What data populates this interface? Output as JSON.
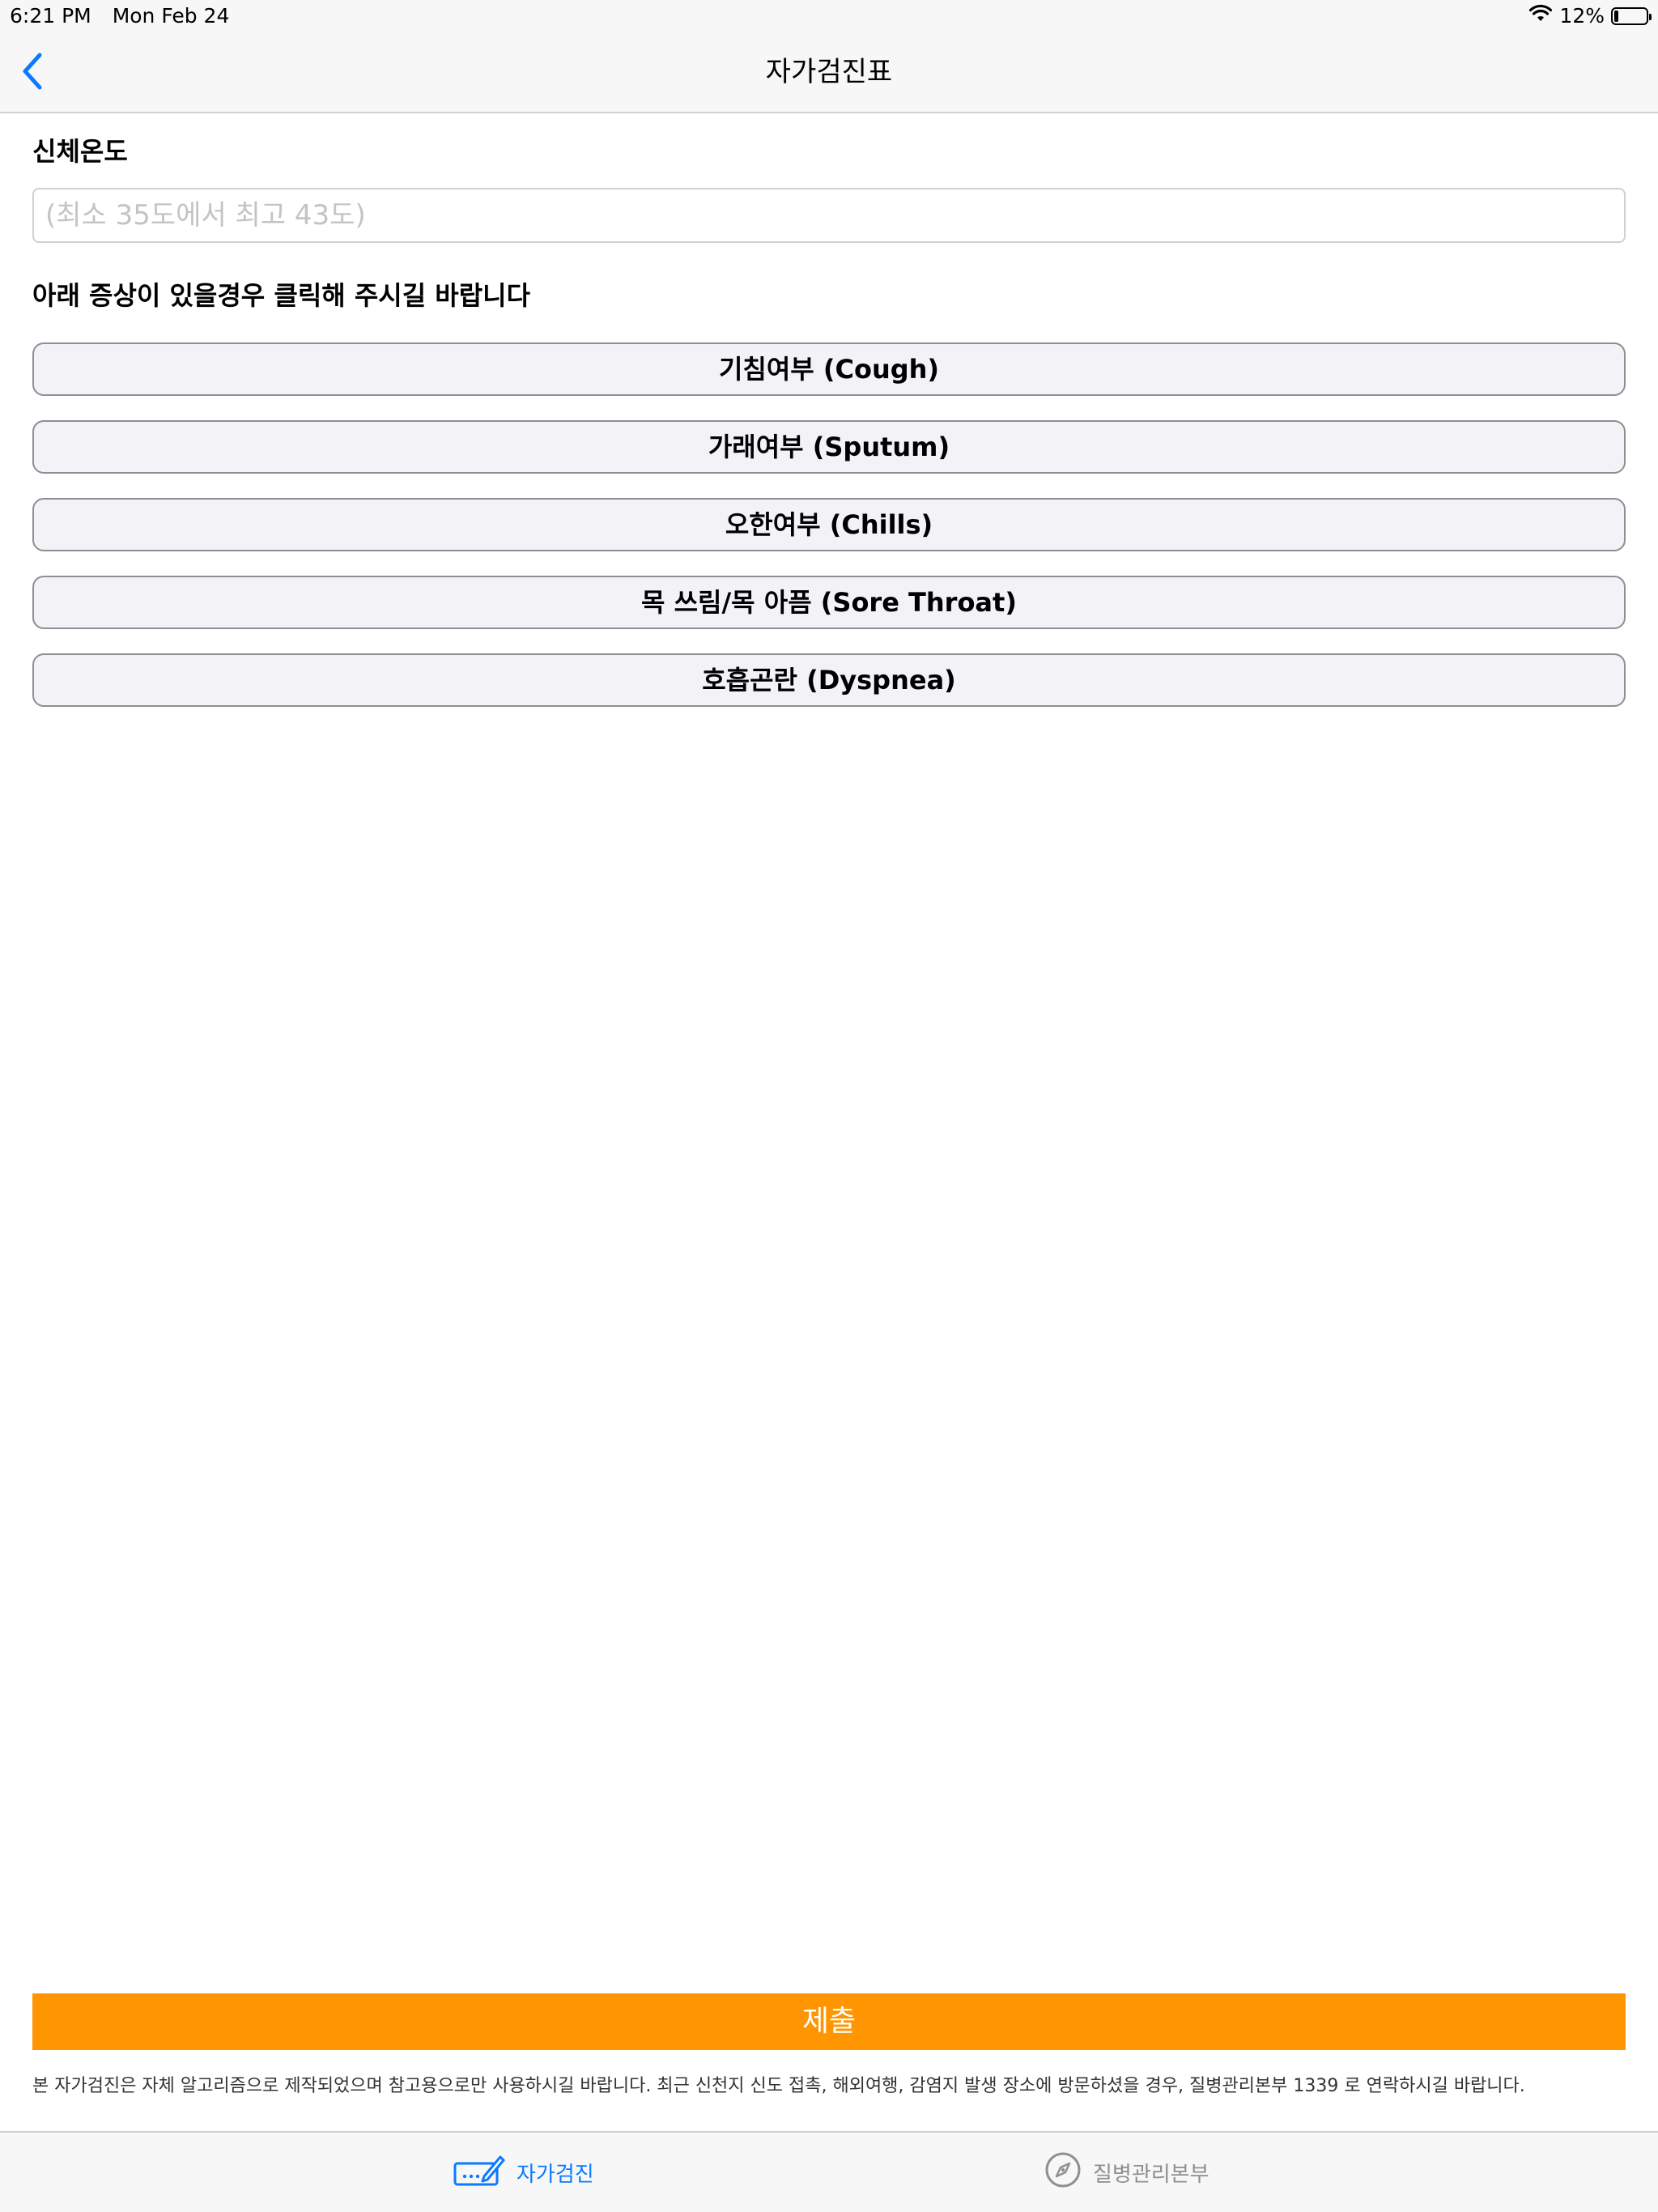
{
  "status_bar": {
    "time": "6:21 PM",
    "date": "Mon Feb 24",
    "battery": "12%",
    "battery_level": 0.12
  },
  "nav": {
    "title": "자가검진표",
    "back_icon": "chevron-left-icon"
  },
  "temperature": {
    "label": "신체온도",
    "placeholder": "(최소 35도에서 최고 43도)",
    "value": ""
  },
  "symptoms": {
    "prompt": "아래 증상이 있을경우 클릭해 주시길 바랍니다",
    "items": [
      {
        "label": "기침여부 (Cough)"
      },
      {
        "label": "가래여부 (Sputum)"
      },
      {
        "label": "오한여부 (Chills)"
      },
      {
        "label": "목 쓰림/목 아픔 (Sore Throat)"
      },
      {
        "label": "호흡곤란 (Dyspnea)"
      }
    ]
  },
  "submit": {
    "label": "제출",
    "color": "#ff9500"
  },
  "disclaimer": "본 자가검진은 자체 알고리즘으로 제작되었으며 참고용으로만 사용하시길 바랍니다. 최근 신천지 신도 접촉, 해외여행, 감염지 발생 장소에 방문하셨을 경우, 질병관리본부 1339 로 연락하시길 바랍니다.",
  "tab_bar": {
    "tabs": [
      {
        "label": "자가검진",
        "icon": "self-check-icon",
        "active": true
      },
      {
        "label": "질병관리본부",
        "icon": "compass-icon",
        "active": false
      }
    ],
    "active_color": "#0a7aff"
  }
}
